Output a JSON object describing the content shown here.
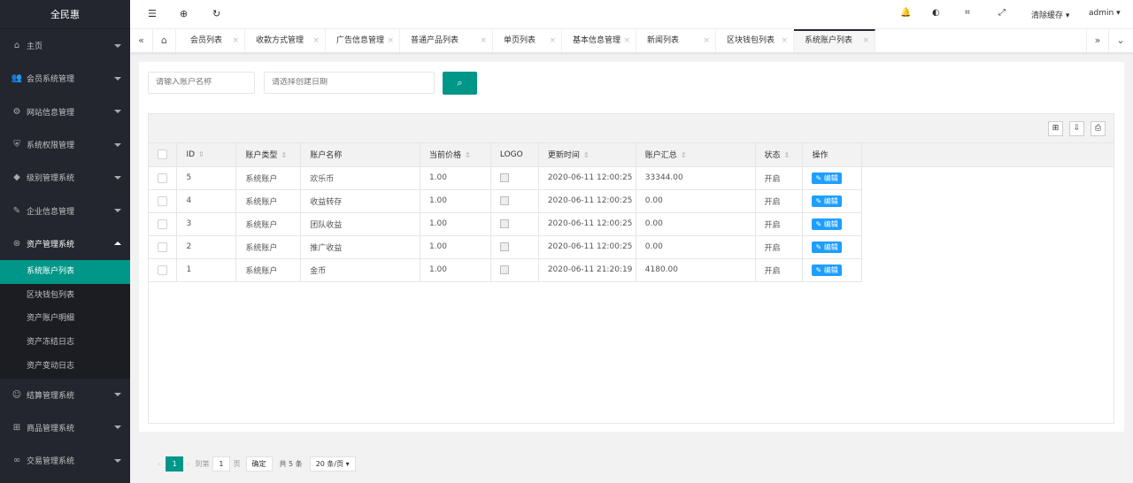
{
  "app": {
    "title": "全民惠"
  },
  "sidebar": {
    "items": [
      {
        "icon": "⌂",
        "icon_name": "home-icon",
        "label": "主页"
      },
      {
        "icon": "👥",
        "icon_name": "users-icon",
        "label": "会员系统管理"
      },
      {
        "icon": "⚙",
        "icon_name": "gear-icon",
        "label": "网站信息管理"
      },
      {
        "icon": "⛨",
        "icon_name": "shield-icon",
        "label": "系统权限管理"
      },
      {
        "icon": "◆",
        "icon_name": "diamond-icon",
        "label": "级别管理系统"
      },
      {
        "icon": "✎",
        "icon_name": "edit-icon",
        "label": "企业信息管理"
      },
      {
        "icon": "⊛",
        "icon_name": "asset-icon",
        "label": "资产管理系统"
      }
    ],
    "sub_items": [
      "系统账户列表",
      "区块钱包列表",
      "资产账户明细",
      "资产冻结日志",
      "资产变动日志"
    ],
    "items_after": [
      {
        "icon": "☺",
        "icon_name": "smile-icon",
        "label": "结算管理系统"
      },
      {
        "icon": "⊞",
        "icon_name": "cart-icon",
        "label": "商品管理系统"
      },
      {
        "icon": "∞",
        "icon_name": "link-icon",
        "label": "交易管理系统"
      }
    ]
  },
  "topbar": {
    "clear_cache": "清除缓存",
    "user": "admin"
  },
  "tabs": [
    "会员列表",
    "收款方式管理",
    "广告信息管理",
    "普通产品列表",
    "单页列表",
    "基本信息管理",
    "新闻列表",
    "区块钱包列表",
    "系统账户列表"
  ],
  "search": {
    "name_placeholder": "请输入账户名称",
    "date_placeholder": "请选择创建日期"
  },
  "table": {
    "headers": [
      "ID",
      "账户类型",
      "账户名称",
      "当前价格",
      "LOGO",
      "更新时间",
      "账户汇总",
      "状态",
      "操作"
    ],
    "rows": [
      {
        "id": "5",
        "type": "系统账户",
        "name": "欢乐币",
        "price": "1.00",
        "time": "2020-06-11 12:00:25",
        "total": "33344.00",
        "status": "开启",
        "action": "编辑"
      },
      {
        "id": "4",
        "type": "系统账户",
        "name": "收益转存",
        "price": "1.00",
        "time": "2020-06-11 12:00:25",
        "total": "0.00",
        "status": "开启",
        "action": "编辑"
      },
      {
        "id": "3",
        "type": "系统账户",
        "name": "团队收益",
        "price": "1.00",
        "time": "2020-06-11 12:00:25",
        "total": "0.00",
        "status": "开启",
        "action": "编辑"
      },
      {
        "id": "2",
        "type": "系统账户",
        "name": "推广收益",
        "price": "1.00",
        "time": "2020-06-11 12:00:25",
        "total": "0.00",
        "status": "开启",
        "action": "编辑"
      },
      {
        "id": "1",
        "type": "系统账户",
        "name": "金币",
        "price": "1.00",
        "time": "2020-06-11 21:20:19",
        "total": "4180.00",
        "status": "开启",
        "action": "编辑"
      }
    ]
  },
  "pager": {
    "current": "1",
    "goto_label": "到第",
    "goto_value": "1",
    "page_unit": "页",
    "confirm": "确定",
    "total": "共 5 条",
    "per_page": "20 条/页"
  },
  "colors": {
    "sidebar_bg": "#23262e",
    "accent": "#009688",
    "edit_button": "#1e9fff"
  }
}
